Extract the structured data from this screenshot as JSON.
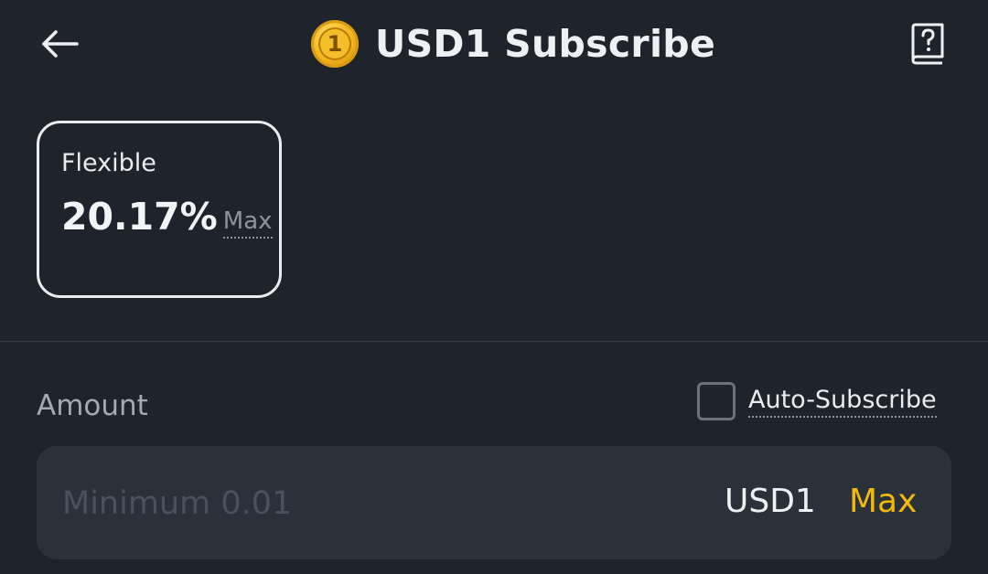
{
  "header": {
    "back_icon": "arrow-left-icon",
    "coin_icon": "usd1-coin-icon",
    "coin_glyph": "1",
    "title": "USD1 Subscribe",
    "help_icon": "help-book-icon"
  },
  "product_card": {
    "type": "Flexible",
    "rate": "20.17%",
    "rate_tag": "Max"
  },
  "amount": {
    "label": "Amount",
    "auto_subscribe_label": "Auto-Subscribe",
    "auto_subscribe_checked": false,
    "placeholder": "Minimum 0.01",
    "value": "",
    "unit": "USD1",
    "max_label": "Max"
  },
  "colors": {
    "background": "#1f232b",
    "input_background": "#2b313b",
    "accent": "#f0b90b",
    "text_primary": "#eaecef",
    "text_secondary": "#a3a9b4"
  }
}
